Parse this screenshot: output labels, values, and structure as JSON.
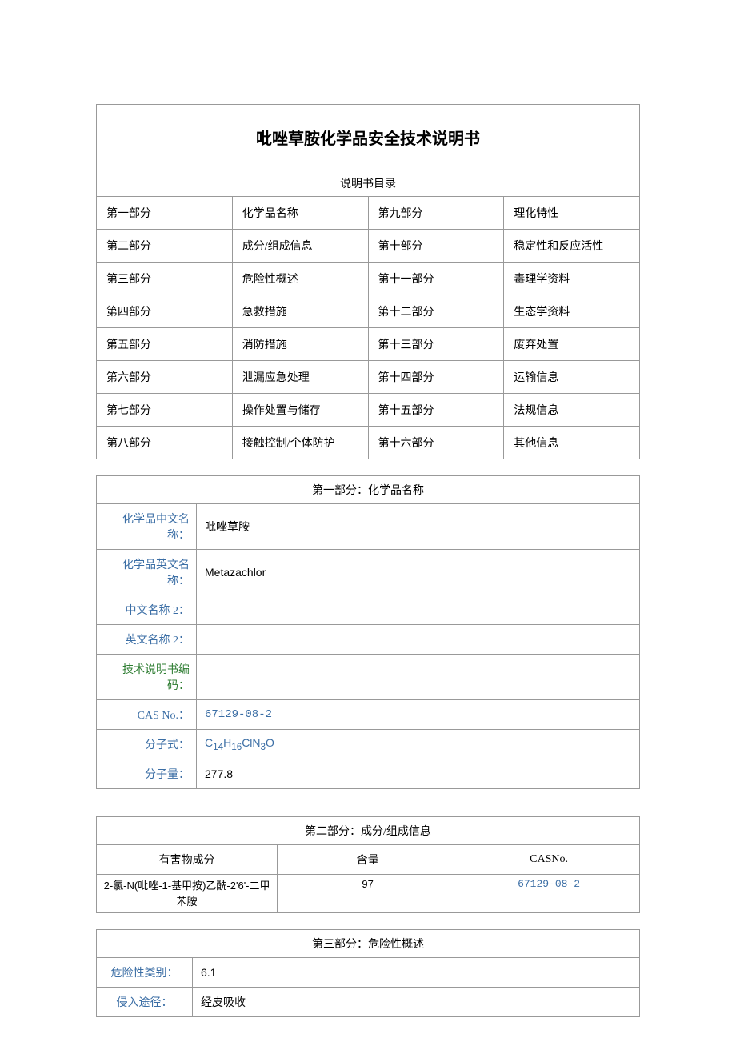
{
  "title": "吡唑草胺化学品安全技术说明书",
  "toc": {
    "header": "说明书目录",
    "rows": [
      [
        "第一部分",
        "化学品名称",
        "第九部分",
        "理化特性"
      ],
      [
        "第二部分",
        "成分/组成信息",
        "第十部分",
        "稳定性和反应活性"
      ],
      [
        "第三部分",
        "危险性概述",
        "第十一部分",
        "毒理学资料"
      ],
      [
        "第四部分",
        "急救措施",
        "第十二部分",
        "生态学资料"
      ],
      [
        "第五部分",
        "消防措施",
        "第十三部分",
        "废弃处置"
      ],
      [
        "第六部分",
        "泄漏应急处理",
        "第十四部分",
        "运输信息"
      ],
      [
        "第七部分",
        "操作处置与储存",
        "第十五部分",
        "法规信息"
      ],
      [
        "第八部分",
        "接触控制/个体防护",
        "第十六部分",
        "其他信息"
      ]
    ]
  },
  "section1": {
    "header": "第一部分：化学品名称",
    "fields": [
      {
        "label": "化学品中文名称：",
        "value": "吡唑草胺",
        "cls": "label-blue"
      },
      {
        "label": "化学品英文名称：",
        "value": "Metazachlor",
        "cls": "label-blue"
      },
      {
        "label": "中文名称 2：",
        "value": "",
        "cls": "label-blue"
      },
      {
        "label": "英文名称 2：",
        "value": "",
        "cls": "label-blue"
      },
      {
        "label": "技术说明书编码：",
        "value": "",
        "cls": "label-green"
      },
      {
        "label": "CAS No.：",
        "value": "67129-08-2",
        "cls": "label-blue"
      },
      {
        "label": "分子式：",
        "value": "C14H16ClN3O",
        "formula": true,
        "cls": "label-blue"
      },
      {
        "label": "分子量：",
        "value": "277.8",
        "cls": "label-blue"
      }
    ]
  },
  "section2": {
    "header": "第二部分：成分/组成信息",
    "cols": [
      "有害物成分",
      "含量",
      "CASNo."
    ],
    "row": [
      "2-氯-N(吡唑-1-基甲按)乙酰-2'6'-二甲苯胺",
      "97",
      "67129-08-2"
    ]
  },
  "section3": {
    "header": "第三部分：危险性概述",
    "rows": [
      {
        "label": "危险性类别：",
        "value": "6.1"
      },
      {
        "label": "侵入途径：",
        "value": "经皮吸收"
      }
    ]
  }
}
